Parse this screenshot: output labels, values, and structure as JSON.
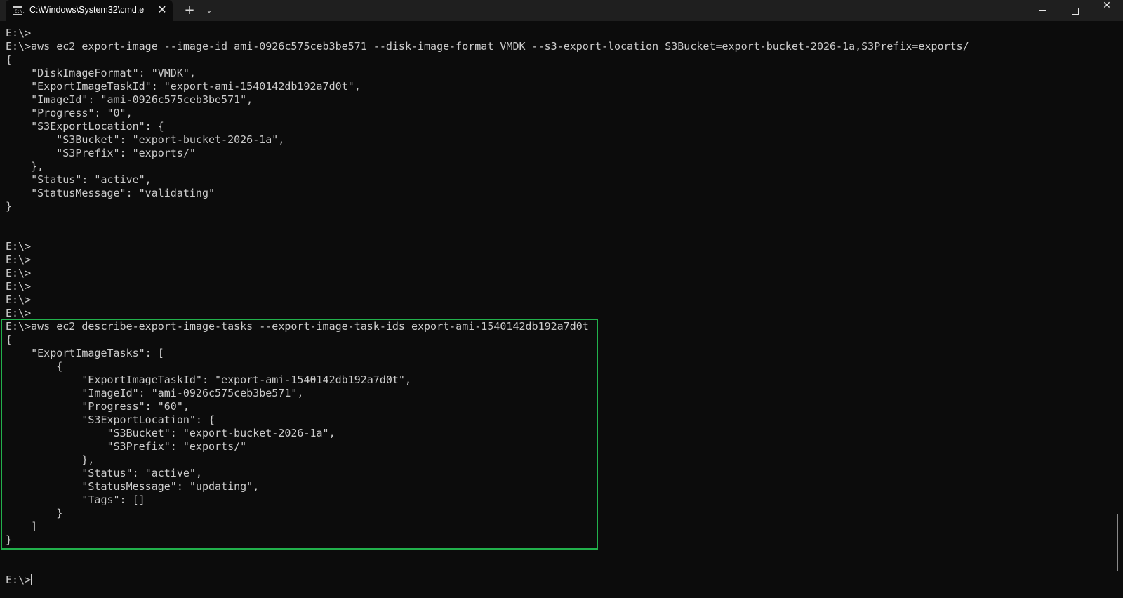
{
  "titlebar": {
    "tab_title": "C:\\Windows\\System32\\cmd.e",
    "tab_icon_text": "C:\\.",
    "close_tab_symbol": "✕",
    "new_tab_symbol": "+",
    "dropdown_symbol": "⌄",
    "close_window_symbol": "✕"
  },
  "terminal": {
    "lines": [
      "E:\\>",
      "E:\\>aws ec2 export-image --image-id ami-0926c575ceb3be571 --disk-image-format VMDK --s3-export-location S3Bucket=export-bucket-2026-1a,S3Prefix=exports/",
      "{",
      "    \"DiskImageFormat\": \"VMDK\",",
      "    \"ExportImageTaskId\": \"export-ami-1540142db192a7d0t\",",
      "    \"ImageId\": \"ami-0926c575ceb3be571\",",
      "    \"Progress\": \"0\",",
      "    \"S3ExportLocation\": {",
      "        \"S3Bucket\": \"export-bucket-2026-1a\",",
      "        \"S3Prefix\": \"exports/\"",
      "    },",
      "    \"Status\": \"active\",",
      "    \"StatusMessage\": \"validating\"",
      "}",
      "",
      "",
      "E:\\>",
      "E:\\>",
      "E:\\>",
      "E:\\>",
      "E:\\>",
      "E:\\>",
      "E:\\>aws ec2 describe-export-image-tasks --export-image-task-ids export-ami-1540142db192a7d0t",
      "{",
      "    \"ExportImageTasks\": [",
      "        {",
      "            \"ExportImageTaskId\": \"export-ami-1540142db192a7d0t\",",
      "            \"ImageId\": \"ami-0926c575ceb3be571\",",
      "            \"Progress\": \"60\",",
      "            \"S3ExportLocation\": {",
      "                \"S3Bucket\": \"export-bucket-2026-1a\",",
      "                \"S3Prefix\": \"exports/\"",
      "            },",
      "            \"Status\": \"active\",",
      "            \"StatusMessage\": \"updating\",",
      "            \"Tags\": []",
      "        }",
      "    ]",
      "}",
      "",
      "",
      "E:\\>"
    ]
  },
  "colors": {
    "background": "#0c0c0c",
    "text": "#cccccc",
    "titlebar": "#1f1f1f",
    "highlight_border": "#22b14c"
  }
}
